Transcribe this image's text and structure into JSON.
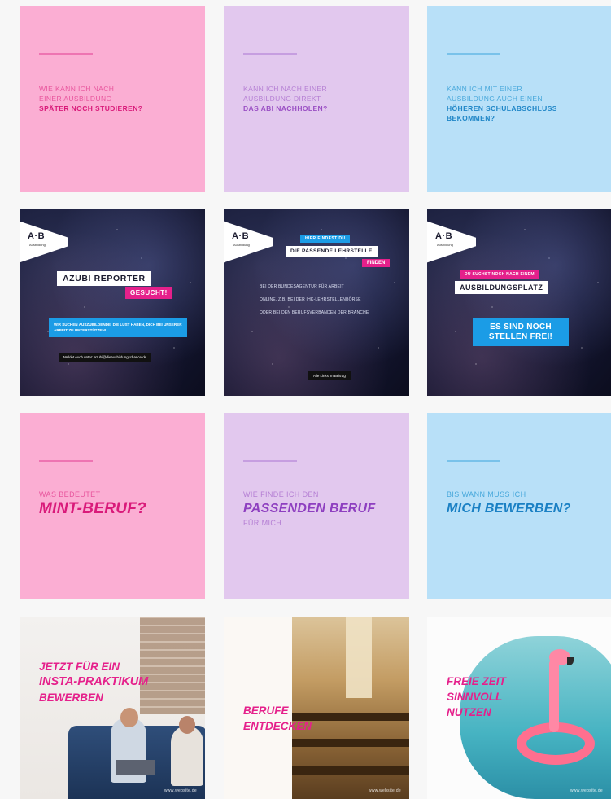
{
  "tiles": {
    "t1": {
      "line1": "Wie kann ich nach",
      "line2": "einer Ausbildung",
      "strong": "später noch studieren?"
    },
    "t2": {
      "line1": "Kann ich nach einer",
      "line2": "Ausbildung direkt",
      "strong": "das Abi nachholen?"
    },
    "t3": {
      "line1": "Kann ich mit einer",
      "line2": "Ausbildung auch einen",
      "strong1": "höheren Schulabschluss",
      "strong2": "bekommen?"
    },
    "t4": {
      "logo": "A·B",
      "logo_sub": "Ausbildung",
      "title": "AZUBI REPORTER",
      "subtitle": "GESUCHT!",
      "body": "Wir suchen Auszubildende, die Lust haben, dich bei unserer Arbeit zu unterstützen!",
      "footer": "Meldet euch unter: azubi@dieausbildungschance.de"
    },
    "t5": {
      "logo": "A·B",
      "logo_sub": "Ausbildung",
      "kicker": "Hier findest Du",
      "title": "DIE PASSENDE LEHRSTELLE",
      "title2": "FINDEN",
      "bullets": [
        "Bei der Bundesagentur für Arbeit",
        "Online, z.B. bei der IHK-Lehrstellenbörse",
        "Oder bei den Berufsverbänden der Branche"
      ],
      "footer": "Alle Links im Beitrag"
    },
    "t6": {
      "logo": "A·B",
      "logo_sub": "Ausbildung",
      "kicker": "Du suchst noch nach einem",
      "title": "AUSBILDUNGSPLATZ",
      "callout1": "ES SIND NOCH",
      "callout2": "STELLEN FREI!"
    },
    "t7": {
      "small": "Was bedeutet",
      "big": "MINT-BERUF?"
    },
    "t8": {
      "small": "Wie finde ich den",
      "big": "PASSENDEN BERUF",
      "small2": "für mich"
    },
    "t9": {
      "small": "Bis wann muss ich",
      "big": "MICH BEWERBEN?"
    },
    "t10": {
      "l1": "JETZT FÜR EIN",
      "l2": "INSTA-PRAKTIKUM",
      "l3": "BEWERBEN",
      "url": "www.website.de"
    },
    "t11": {
      "l1": "BERUFE",
      "l2": "ENTDECKEN",
      "url": "www.website.de"
    },
    "t12": {
      "l1": "FREIE ZEIT",
      "l2": "SINNVOLL",
      "l3": "NUTZEN",
      "url": "www.website.de"
    }
  },
  "colors": {
    "pink": "#fbaed3",
    "lilac": "#e2c8ee",
    "blue": "#b8e0f8",
    "accent_pink": "#e5208b",
    "accent_blue": "#1b9ce6"
  }
}
